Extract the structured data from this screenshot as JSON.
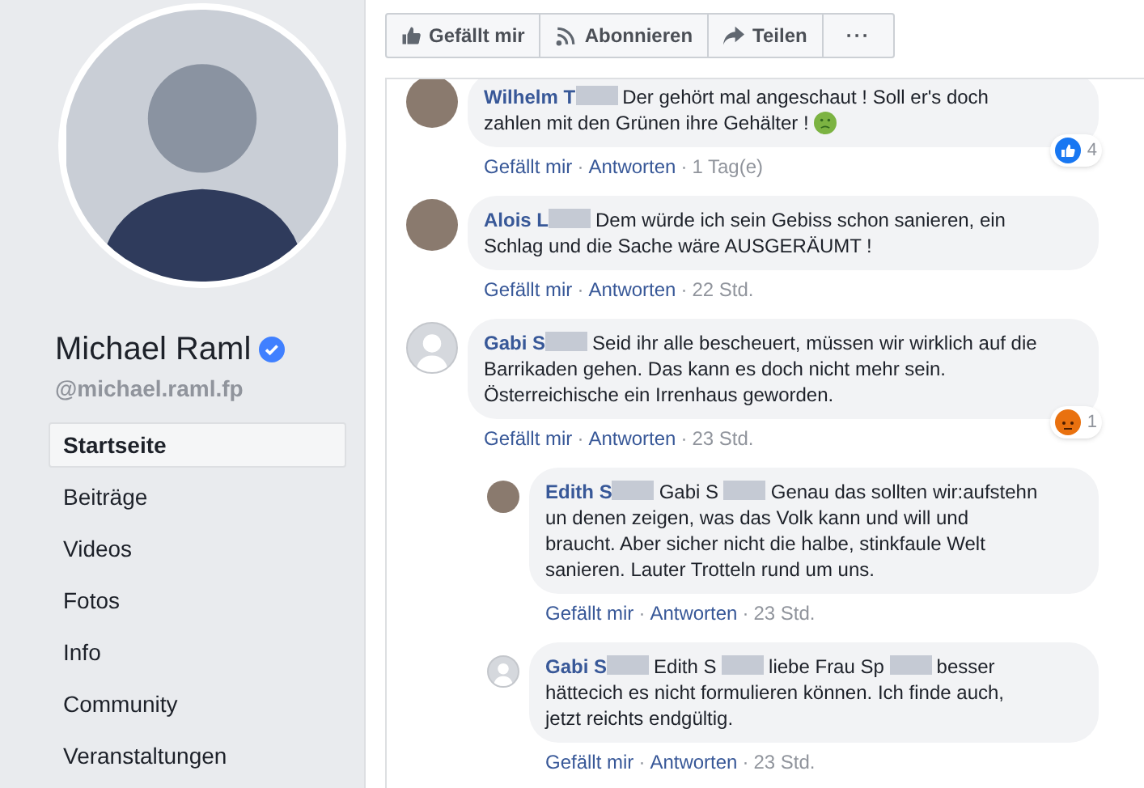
{
  "profile": {
    "name": "Michael Raml",
    "verified": true,
    "handle": "@michael.raml.fp"
  },
  "nav": [
    {
      "label": "Startseite",
      "selected": true
    },
    {
      "label": "Beiträge",
      "selected": false
    },
    {
      "label": "Videos",
      "selected": false
    },
    {
      "label": "Fotos",
      "selected": false
    },
    {
      "label": "Info",
      "selected": false
    },
    {
      "label": "Community",
      "selected": false
    },
    {
      "label": "Veranstaltungen",
      "selected": false
    }
  ],
  "actions": [
    {
      "kind": "like",
      "label": "Gefällt mir"
    },
    {
      "kind": "follow",
      "label": "Abonnieren"
    },
    {
      "kind": "share",
      "label": "Teilen"
    },
    {
      "kind": "more",
      "label": "···"
    }
  ],
  "comments": [
    {
      "reply": false,
      "avatar": {
        "kind": "photo"
      },
      "segments": [
        {
          "kind": "name",
          "text": "Wilhelm T"
        },
        {
          "kind": "blur"
        },
        {
          "kind": "text",
          "text": "Der gehört mal angeschaut ! Soll er's doch zahlen mit den Grünen ihre Gehälter !"
        },
        {
          "kind": "emoji"
        }
      ],
      "meta": [
        {
          "kind": "like",
          "text": "Gefällt mir"
        },
        {
          "kind": "sep",
          "text": "·"
        },
        {
          "kind": "reply",
          "text": "Antworten"
        },
        {
          "kind": "sep",
          "text": "·"
        },
        {
          "kind": "time",
          "text": "1 Tag(e)"
        }
      ],
      "reaction": {
        "kind": "like",
        "count": "4"
      }
    },
    {
      "reply": false,
      "avatar": {
        "kind": "photo"
      },
      "segments": [
        {
          "kind": "name",
          "text": "Alois L"
        },
        {
          "kind": "blur"
        },
        {
          "kind": "text",
          "text": "Dem würde ich sein Gebiss schon sanieren, ein Schlag und die Sache wäre AUSGERÄUMT !"
        }
      ],
      "meta": [
        {
          "kind": "like",
          "text": "Gefällt mir"
        },
        {
          "kind": "sep",
          "text": "·"
        },
        {
          "kind": "reply",
          "text": "Antworten"
        },
        {
          "kind": "sep",
          "text": "·"
        },
        {
          "kind": "time",
          "text": "22 Std."
        }
      ]
    },
    {
      "reply": false,
      "avatar": {
        "kind": "default"
      },
      "segments": [
        {
          "kind": "name",
          "text": "Gabi S"
        },
        {
          "kind": "blur"
        },
        {
          "kind": "text",
          "text": "Seid ihr alle bescheuert, müssen wir wirklich auf die Barrikaden gehen. Das kann es doch nicht mehr sein. Österreichische ein Irrenhaus geworden."
        }
      ],
      "meta": [
        {
          "kind": "like",
          "text": "Gefällt mir"
        },
        {
          "kind": "sep",
          "text": "·"
        },
        {
          "kind": "reply",
          "text": "Antworten"
        },
        {
          "kind": "sep",
          "text": "·"
        },
        {
          "kind": "time",
          "text": "23 Std."
        }
      ],
      "reaction": {
        "kind": "angry",
        "count": "1"
      }
    },
    {
      "reply": true,
      "avatar": {
        "kind": "photo"
      },
      "segments": [
        {
          "kind": "name",
          "text": "Edith S"
        },
        {
          "kind": "blur"
        },
        {
          "kind": "text",
          "text": "Gabi S"
        },
        {
          "kind": "blur"
        },
        {
          "kind": "text",
          "text": "Genau das sollten wir:aufstehn un denen zeigen, was das Volk kann und will und braucht. Aber sicher nicht die halbe, stinkfaule Welt sanieren. Lauter Trotteln rund um uns."
        }
      ],
      "meta": [
        {
          "kind": "like",
          "text": "Gefällt mir"
        },
        {
          "kind": "sep",
          "text": "·"
        },
        {
          "kind": "reply",
          "text": "Antworten"
        },
        {
          "kind": "sep",
          "text": "·"
        },
        {
          "kind": "time",
          "text": "23 Std."
        }
      ]
    },
    {
      "reply": true,
      "avatar": {
        "kind": "default"
      },
      "segments": [
        {
          "kind": "name",
          "text": "Gabi S"
        },
        {
          "kind": "blur"
        },
        {
          "kind": "text",
          "text": "Edith S"
        },
        {
          "kind": "blur"
        },
        {
          "kind": "text",
          "text": "liebe Frau Sp"
        },
        {
          "kind": "blur"
        },
        {
          "kind": "text",
          "text": "besser hättecich es nicht formulieren können. Ich finde auch, jetzt reichts endgültig."
        }
      ],
      "meta": [
        {
          "kind": "like",
          "text": "Gefällt mir"
        },
        {
          "kind": "sep",
          "text": "·"
        },
        {
          "kind": "reply",
          "text": "Antworten"
        },
        {
          "kind": "sep",
          "text": "·"
        },
        {
          "kind": "time",
          "text": "23 Std."
        }
      ]
    }
  ]
}
